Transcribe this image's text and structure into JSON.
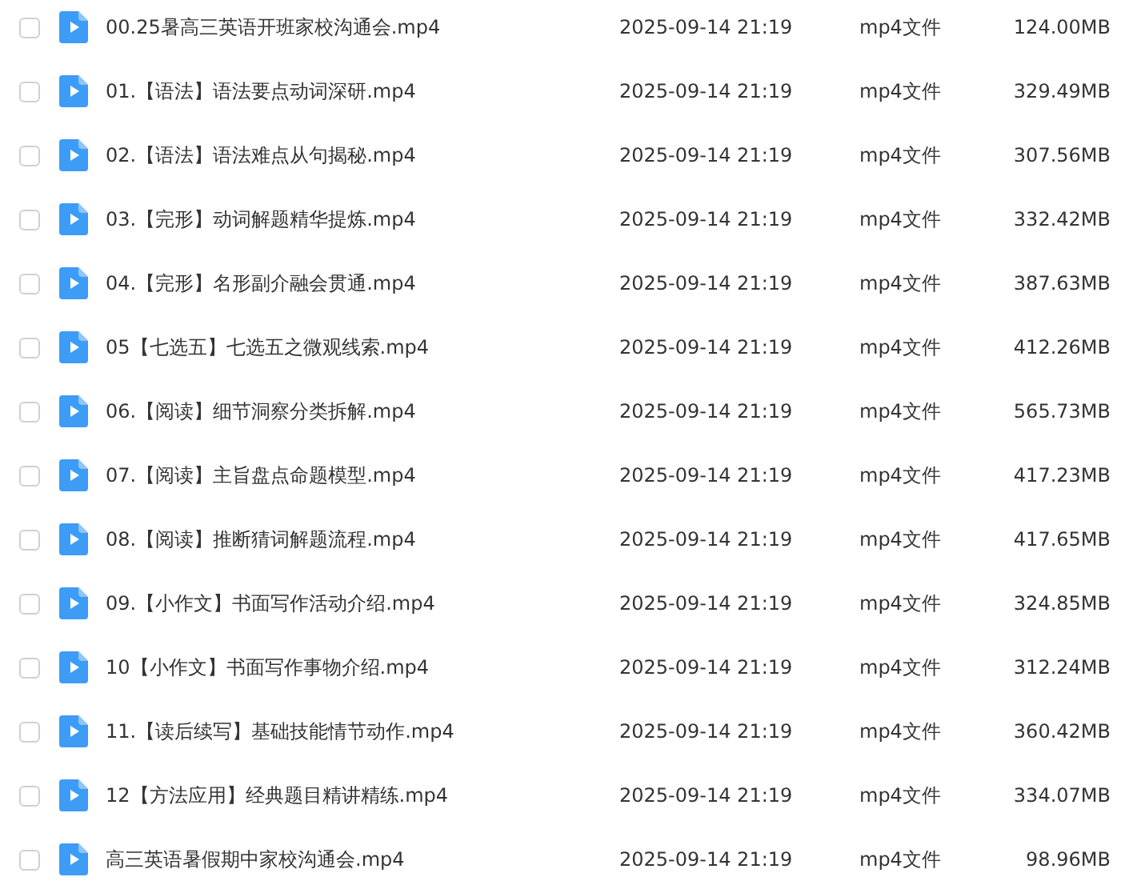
{
  "files": [
    {
      "name": "00.25暑高三英语开班家校沟通会.mp4",
      "modified": "2025-09-14 21:19",
      "type": "mp4文件",
      "size": "124.00MB",
      "checked": false
    },
    {
      "name": "01.【语法】语法要点动词深研.mp4",
      "modified": "2025-09-14 21:19",
      "type": "mp4文件",
      "size": "329.49MB",
      "checked": false
    },
    {
      "name": "02.【语法】语法难点从句揭秘.mp4",
      "modified": "2025-09-14 21:19",
      "type": "mp4文件",
      "size": "307.56MB",
      "checked": false
    },
    {
      "name": "03.【完形】动词解题精华提炼.mp4",
      "modified": "2025-09-14 21:19",
      "type": "mp4文件",
      "size": "332.42MB",
      "checked": false
    },
    {
      "name": "04.【完形】名形副介融会贯通.mp4",
      "modified": "2025-09-14 21:19",
      "type": "mp4文件",
      "size": "387.63MB",
      "checked": false
    },
    {
      "name": "05【七选五】七选五之微观线索.mp4",
      "modified": "2025-09-14 21:19",
      "type": "mp4文件",
      "size": "412.26MB",
      "checked": false
    },
    {
      "name": "06.【阅读】细节洞察分类拆解.mp4",
      "modified": "2025-09-14 21:19",
      "type": "mp4文件",
      "size": "565.73MB",
      "checked": false
    },
    {
      "name": "07.【阅读】主旨盘点命题模型.mp4",
      "modified": "2025-09-14 21:19",
      "type": "mp4文件",
      "size": "417.23MB",
      "checked": false
    },
    {
      "name": "08.【阅读】推断猜词解题流程.mp4",
      "modified": "2025-09-14 21:19",
      "type": "mp4文件",
      "size": "417.65MB",
      "checked": false
    },
    {
      "name": "09.【小作文】书面写作活动介绍.mp4",
      "modified": "2025-09-14 21:19",
      "type": "mp4文件",
      "size": "324.85MB",
      "checked": false
    },
    {
      "name": "10【小作文】书面写作事物介绍.mp4",
      "modified": "2025-09-14 21:19",
      "type": "mp4文件",
      "size": "312.24MB",
      "checked": false
    },
    {
      "name": "11.【读后续写】基础技能情节动作.mp4",
      "modified": "2025-09-14 21:19",
      "type": "mp4文件",
      "size": "360.42MB",
      "checked": false
    },
    {
      "name": "12【方法应用】经典题目精讲精练.mp4",
      "modified": "2025-09-14 21:19",
      "type": "mp4文件",
      "size": "334.07MB",
      "checked": false
    },
    {
      "name": "高三英语暑假期中家校沟通会.mp4",
      "modified": "2025-09-14 21:19",
      "type": "mp4文件",
      "size": "98.96MB",
      "checked": false
    }
  ]
}
